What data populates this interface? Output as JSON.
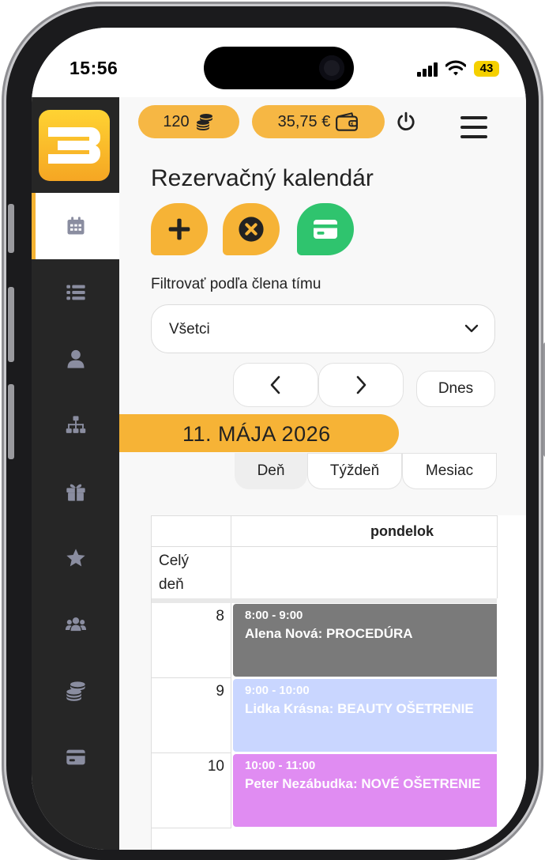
{
  "status_bar": {
    "time": "15:56",
    "battery": "43"
  },
  "header": {
    "credits": "120",
    "wallet": "35,75 €"
  },
  "page": {
    "title": "Rezervačný kalendár"
  },
  "filter": {
    "label": "Filtrovať podľa člena tímu",
    "selected": "Všetci"
  },
  "navigation": {
    "today_label": "Dnes"
  },
  "date": "11. MÁJA 2026",
  "views": [
    {
      "label": "Deň",
      "active": true
    },
    {
      "label": "Týždeň",
      "active": false
    },
    {
      "label": "Mesiac",
      "active": false
    }
  ],
  "calendar": {
    "day_header": "pondelok",
    "all_day_label": "Celý deň",
    "hours": [
      "8",
      "9",
      "10"
    ],
    "events": [
      {
        "time": "8:00 - 9:00",
        "title": "Alena Nová: PROCEDÚRA",
        "color": "#7a7a7a"
      },
      {
        "time": "9:00 - 10:00",
        "title": "Lidka Krásna: BEAUTY OŠETRENIE",
        "color": "#c9d6ff"
      },
      {
        "time": "10:00 - 11:00",
        "title": "Peter Nezábudka: NOVÉ OŠETRENIE",
        "color": "#e08cf2"
      }
    ]
  },
  "sidebar": {
    "items": [
      {
        "icon": "calendar-icon",
        "active": true
      },
      {
        "icon": "list-icon",
        "active": false
      },
      {
        "icon": "user-icon",
        "active": false
      },
      {
        "icon": "sitemap-icon",
        "active": false
      },
      {
        "icon": "gift-icon",
        "active": false
      },
      {
        "icon": "star-icon",
        "active": false
      },
      {
        "icon": "users-icon",
        "active": false
      },
      {
        "icon": "coins-icon",
        "active": false
      },
      {
        "icon": "credit-card-icon",
        "active": false
      }
    ]
  },
  "colors": {
    "accent": "#f6b744",
    "sidebar_bg": "#262626",
    "sidebar_icon": "#8a8da0",
    "action_add": "#f6b336",
    "action_cancel": "#f6b336",
    "action_pay": "#2fc46e"
  }
}
